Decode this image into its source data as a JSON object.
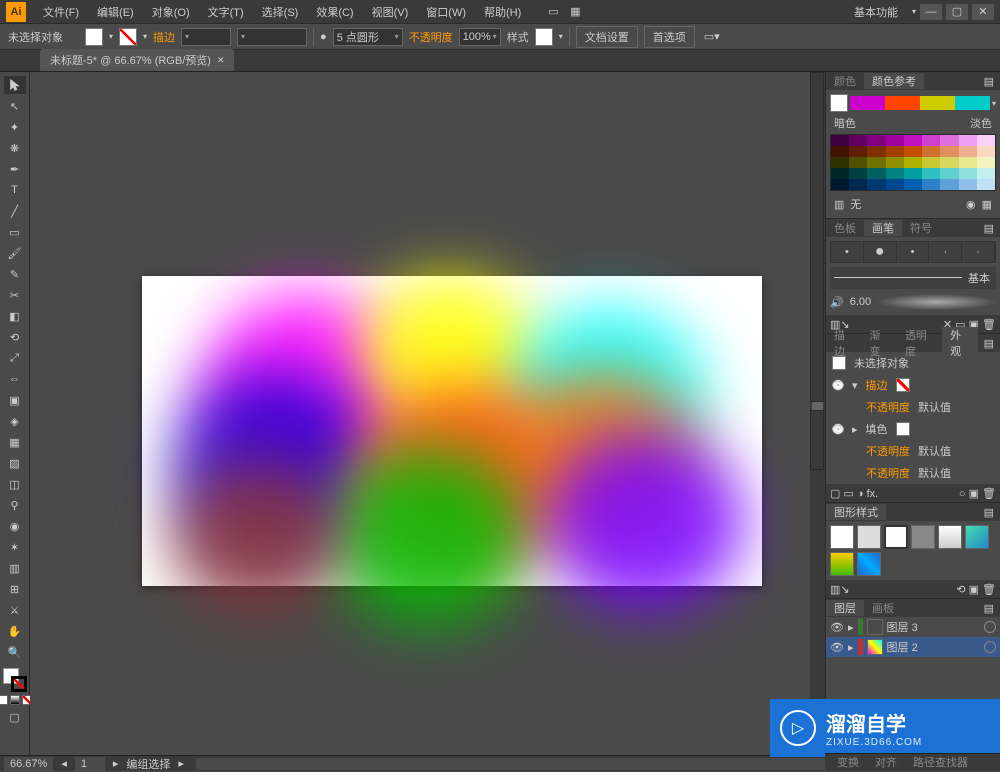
{
  "menubar": {
    "items": [
      "文件(F)",
      "编辑(E)",
      "对象(O)",
      "文字(T)",
      "选择(S)",
      "效果(C)",
      "视图(V)",
      "窗口(W)",
      "帮助(H)"
    ],
    "workspace": "基本功能"
  },
  "controlbar": {
    "no_selection": "未选择对象",
    "stroke": "描边",
    "weight_label": "5 点圆形",
    "opacity_label": "不透明度",
    "opacity_value": "100%",
    "style": "样式",
    "doc_setup": "文档设置",
    "prefs": "首选项"
  },
  "doctab": {
    "title": "未标题-5* @ 66.67% (RGB/预览)"
  },
  "panels": {
    "color": {
      "tabs": [
        "颜色",
        "颜色参考"
      ],
      "dark": "暗色",
      "light": "淡色",
      "none": "无"
    },
    "brush": {
      "tabs": [
        "色板",
        "画笔",
        "符号"
      ],
      "basic": "基本",
      "size": "6.00"
    },
    "appearance": {
      "tabs": [
        "描边",
        "渐变",
        "透明度",
        "外观"
      ],
      "no_sel": "未选择对象",
      "stroke": "描边",
      "fill": "填色",
      "opacity": "不透明度",
      "default": "默认值"
    },
    "styles": {
      "tabs": [
        "图形样式"
      ]
    },
    "layers": {
      "tabs": [
        "图层",
        "画板"
      ],
      "items": [
        {
          "name": "图层 3",
          "color": "#3a7a30"
        },
        {
          "name": "图层 2",
          "color": "#c03030"
        }
      ]
    },
    "bottom": {
      "tabs": [
        "变换",
        "对齐",
        "路径查找器"
      ]
    }
  },
  "statusbar": {
    "zoom": "66.67%",
    "artboard": "1",
    "tool": "编组选择"
  },
  "watermark": {
    "title": "溜溜自学",
    "sub": "ZIXUE.3D66.COM"
  }
}
